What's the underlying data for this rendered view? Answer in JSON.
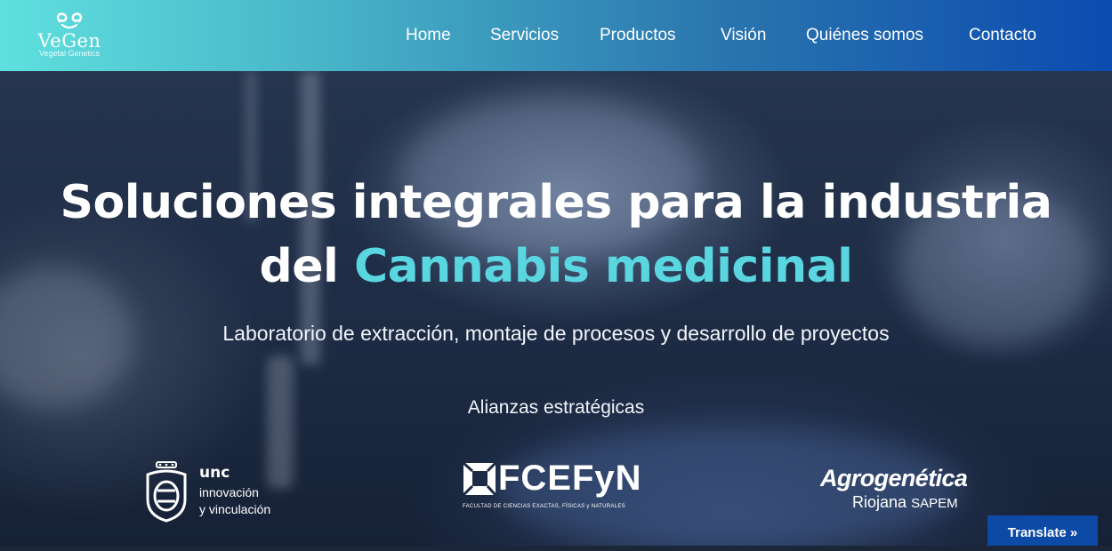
{
  "header": {
    "logo": {
      "name": "VeGen",
      "tagline": "Vegetal Genetics"
    },
    "nav": [
      {
        "label": "Home"
      },
      {
        "label": "Servicios"
      },
      {
        "label": "Productos"
      },
      {
        "label": "Visión"
      },
      {
        "label": "Quiénes somos"
      },
      {
        "label": "Contacto"
      }
    ]
  },
  "hero": {
    "title_line1": "Soluciones integrales para la industria",
    "title_line2_prefix": "del",
    "title_line2_accent": "Cannabis medicinal",
    "subtitle": "Laboratorio de extracción, montaje de procesos y desarrollo de proyectos",
    "alliances_heading": "Alianzas estratégicas"
  },
  "partners": {
    "unc": {
      "abbr": "unc",
      "line1": "innovación",
      "line2": "y vinculación",
      "icon": "university-seal-icon"
    },
    "fcefyn": {
      "name": "FCEFyN",
      "sub": "FACULTAD DE CIENCIAS EXACTAS, FÍSICAS y NATURALES",
      "icon": "fcefyn-mark-icon"
    },
    "agro": {
      "name": "Agrogenética",
      "sub_main": "Riojana",
      "sub_small": "SAPEM"
    }
  },
  "translate": {
    "label": "Translate »"
  },
  "colors": {
    "header_gradient_start": "#5fe0de",
    "header_gradient_end": "#0b4bb0",
    "accent": "#5ad6e0",
    "translate_bg": "#0c4aa5"
  }
}
